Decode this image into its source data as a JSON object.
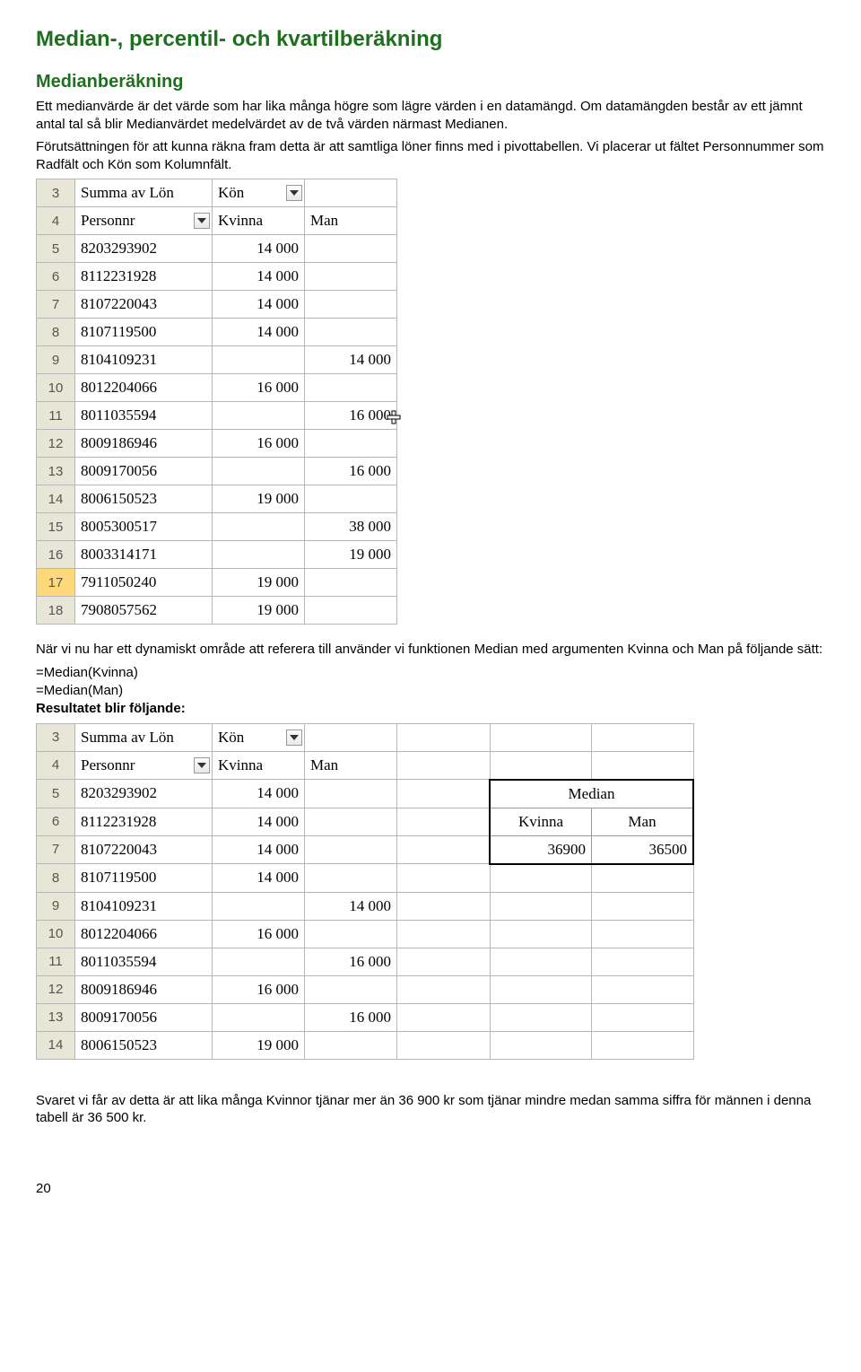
{
  "headings": {
    "h1": "Median-, percentil- och kvartilberäkning",
    "h2": "Medianberäkning"
  },
  "paragraphs": {
    "p1": "Ett medianvärde är det värde som har lika många högre som lägre värden i en datamängd. Om datamängden består av ett jämnt antal tal så blir Medianvärdet medelvärdet av de två värden närmast Medianen.",
    "p2": "Förutsättningen för att kunna räkna fram detta är att samtliga löner finns med i pivottabellen. Vi placerar ut fältet Personnummer som Radfält och Kön som Kolumnfält.",
    "p3": "När vi nu har ett dynamiskt område att referera till använder vi funktionen Median med argumenten Kvinna och Man på följande sätt:",
    "f1": "=Median(Kvinna)",
    "f2": "=Median(Man)",
    "result_label": "Resultatet blir följande:",
    "p4": "Svaret vi får av detta är att lika många Kvinnor tjänar mer än 36 900 kr som tjänar mindre medan samma siffra för männen i denna tabell är 36 500 kr."
  },
  "table1": {
    "header_field": "Summa av Lön",
    "col_field": "Kön",
    "row_field": "Personnr",
    "col1": "Kvinna",
    "col2": "Man",
    "rows": [
      {
        "n": "5",
        "pnr": "8203293902",
        "kv": "14 000",
        "man": ""
      },
      {
        "n": "6",
        "pnr": "8112231928",
        "kv": "14 000",
        "man": ""
      },
      {
        "n": "7",
        "pnr": "8107220043",
        "kv": "14 000",
        "man": ""
      },
      {
        "n": "8",
        "pnr": "8107119500",
        "kv": "14 000",
        "man": ""
      },
      {
        "n": "9",
        "pnr": "8104109231",
        "kv": "",
        "man": "14 000"
      },
      {
        "n": "10",
        "pnr": "8012204066",
        "kv": "16 000",
        "man": ""
      },
      {
        "n": "11",
        "pnr": "8011035594",
        "kv": "",
        "man": "16 000"
      },
      {
        "n": "12",
        "pnr": "8009186946",
        "kv": "16 000",
        "man": ""
      },
      {
        "n": "13",
        "pnr": "8009170056",
        "kv": "",
        "man": "16 000"
      },
      {
        "n": "14",
        "pnr": "8006150523",
        "kv": "19 000",
        "man": ""
      },
      {
        "n": "15",
        "pnr": "8005300517",
        "kv": "",
        "man": "38 000"
      },
      {
        "n": "16",
        "pnr": "8003314171",
        "kv": "",
        "man": "19 000"
      },
      {
        "n": "17",
        "pnr": "7911050240",
        "kv": "19 000",
        "man": ""
      },
      {
        "n": "18",
        "pnr": "7908057562",
        "kv": "19 000",
        "man": ""
      }
    ]
  },
  "table2": {
    "header_field": "Summa av Lön",
    "col_field": "Kön",
    "row_field": "Personnr",
    "col1": "Kvinna",
    "col2": "Man",
    "median_label": "Median",
    "median_kv_label": "Kvinna",
    "median_man_label": "Man",
    "median_kv": "36900",
    "median_man": "36500",
    "rows": [
      {
        "n": "5",
        "pnr": "8203293902",
        "kv": "14 000",
        "man": ""
      },
      {
        "n": "6",
        "pnr": "8112231928",
        "kv": "14 000",
        "man": ""
      },
      {
        "n": "7",
        "pnr": "8107220043",
        "kv": "14 000",
        "man": ""
      },
      {
        "n": "8",
        "pnr": "8107119500",
        "kv": "14 000",
        "man": ""
      },
      {
        "n": "9",
        "pnr": "8104109231",
        "kv": "",
        "man": "14 000"
      },
      {
        "n": "10",
        "pnr": "8012204066",
        "kv": "16 000",
        "man": ""
      },
      {
        "n": "11",
        "pnr": "8011035594",
        "kv": "",
        "man": "16 000"
      },
      {
        "n": "12",
        "pnr": "8009186946",
        "kv": "16 000",
        "man": ""
      },
      {
        "n": "13",
        "pnr": "8009170056",
        "kv": "",
        "man": "16 000"
      },
      {
        "n": "14",
        "pnr": "8006150523",
        "kv": "19 000",
        "man": ""
      }
    ]
  },
  "page_number": "20"
}
